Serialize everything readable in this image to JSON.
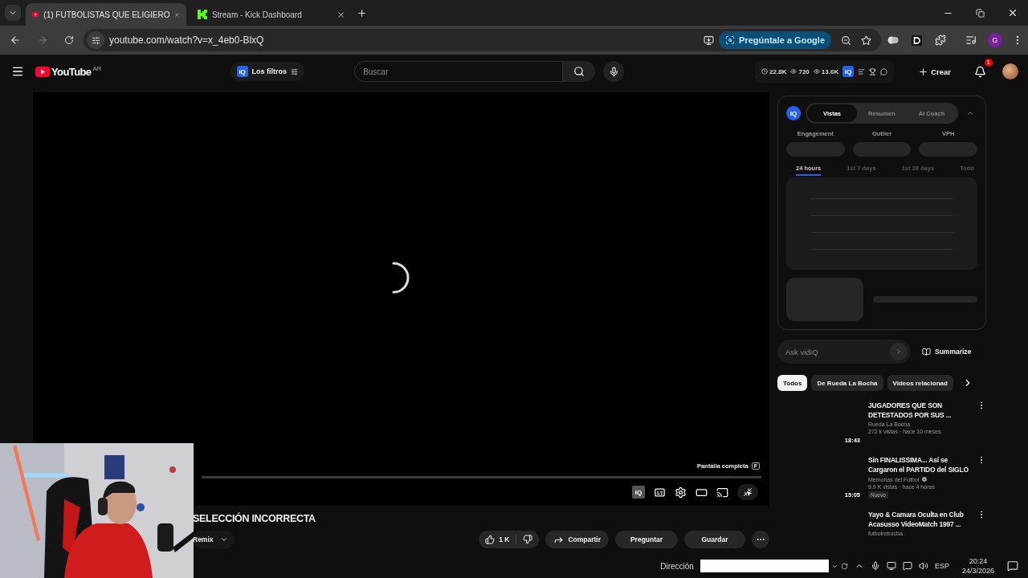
{
  "browser": {
    "tabs": [
      {
        "kind": "youtube",
        "title": "(1) FUTBOLISTAS QUE ELIGIERO",
        "selected": true
      },
      {
        "kind": "kick",
        "title": "Stream - Kick Dashboard",
        "selected": false
      }
    ],
    "url": "youtube.com/watch?v=x_4eb0-BlxQ",
    "ask_google": "Pregúntale a Google",
    "profile": "G"
  },
  "header": {
    "logo": "YouTube",
    "country": "AR",
    "filter_badge": "IQ",
    "filter": "Los filtros",
    "search": {
      "placeholder": "Buscar"
    },
    "stats": [
      "22.8K",
      "720",
      "13.6K"
    ],
    "stats_badge": "IQ",
    "create": "Crear",
    "notifications": "1"
  },
  "player": {
    "tooltip": "Pantalla completa",
    "shortcut": "F",
    "badge": "IQ"
  },
  "video": {
    "title": "SELECCIÓN INCORRECTA",
    "remix": "Remix",
    "likes": "1 K",
    "share": "Compartir",
    "ask": "Preguntar",
    "save": "Guardar"
  },
  "vidiq": {
    "badge": "IQ",
    "tabs": [
      {
        "label": "Vistas",
        "selected": true
      },
      {
        "label": "Resumen",
        "selected": false
      },
      {
        "label": "AI Coach",
        "selected": false
      }
    ],
    "metrics": [
      "Engagement",
      "Outlier",
      "VPH"
    ],
    "periods": [
      {
        "label": "24 hours",
        "selected": true
      },
      {
        "label": "1st 7 days",
        "selected": false
      },
      {
        "label": "1st 28 days",
        "selected": false
      },
      {
        "label": "Todo",
        "selected": false
      }
    ],
    "ask": {
      "placeholder": "Ask vidIQ"
    },
    "summarize": "Summarize"
  },
  "chips": [
    {
      "label": "Todos",
      "selected": true
    },
    {
      "label": "De Rueda La Bocha",
      "selected": false
    },
    {
      "label": "Videos relacionad",
      "selected": false
    }
  ],
  "related": [
    {
      "title": "JUGADORES QUE SON DETESTADOS POR SUS ...",
      "channel": "Rueda La Bocha",
      "verified": false,
      "meta": "272 k vistas · hace 10 meses",
      "duration": "18:43"
    },
    {
      "title": "Sin FINALISSIMA... Así se Cargaron el PARTIDO del SIGLO",
      "channel": "Memorias del Fútbol",
      "verified": true,
      "meta": "9.9 K vistas · hace 4 horas",
      "duration": "15:05",
      "badge": "Nuevo"
    },
    {
      "title": "Yayo & Camara Oculta en Club Acasusso VideoMatch 1997 ...",
      "channel": "futbolretrocba",
      "verified": false
    }
  ],
  "taskbar": {
    "address_label": "Dirección",
    "language": "ESP",
    "time": "20:24",
    "date": "24/3/2026"
  }
}
